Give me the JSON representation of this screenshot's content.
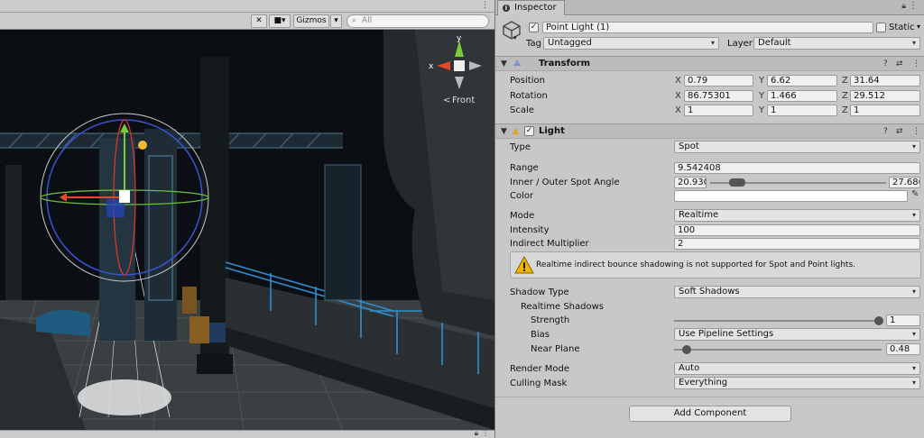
{
  "scene": {
    "gizmos_label": "Gizmos",
    "search_placeholder": "All",
    "orientation_label": "Front",
    "axis_x": "x",
    "axis_y": "y"
  },
  "inspector": {
    "tab_title": "Inspector",
    "object": {
      "active": true,
      "name": "Point Light (1)",
      "static_label": "Static",
      "tag_label": "Tag",
      "tag_value": "Untagged",
      "layer_label": "Layer",
      "layer_value": "Default"
    },
    "transform": {
      "title": "Transform",
      "rows": [
        {
          "label": "Position",
          "x": "0.79",
          "y": "6.62",
          "z": "31.64"
        },
        {
          "label": "Rotation",
          "x": "86.75301",
          "y": "1.466",
          "z": "29.512"
        },
        {
          "label": "Scale",
          "x": "1",
          "y": "1",
          "z": "1"
        }
      ],
      "axis_x": "X",
      "axis_y": "Y",
      "axis_z": "Z"
    },
    "light": {
      "title": "Light",
      "type_label": "Type",
      "type_value": "Spot",
      "range_label": "Range",
      "range_value": "9.542408",
      "angle_label": "Inner / Outer Spot Angle",
      "inner_value": "20.930",
      "outer_value": "27.686",
      "color_label": "Color",
      "mode_label": "Mode",
      "mode_value": "Realtime",
      "intensity_label": "Intensity",
      "intensity_value": "100",
      "indirect_label": "Indirect Multiplier",
      "indirect_value": "2",
      "warning": "Realtime indirect bounce shadowing is not supported for Spot and Point lights.",
      "shadow_type_label": "Shadow Type",
      "shadow_type_value": "Soft Shadows",
      "realtime_shadows_label": "Realtime Shadows",
      "strength_label": "Strength",
      "strength_value": "1",
      "bias_label": "Bias",
      "bias_value": "Use Pipeline Settings",
      "near_plane_label": "Near Plane",
      "near_plane_value": "0.48",
      "render_mode_label": "Render Mode",
      "render_mode_value": "Auto",
      "culling_mask_label": "Culling Mask",
      "culling_mask_value": "Everything"
    },
    "add_component_label": "Add Component"
  },
  "colors": {
    "panel_bg": "#c8c8c8",
    "header_bg": "#bcbcbc",
    "scene_bg": "#0b0f13",
    "axis_red": "#e04a2a",
    "axis_green": "#7ccc3a",
    "rail_blue": "#2e8fd0"
  }
}
